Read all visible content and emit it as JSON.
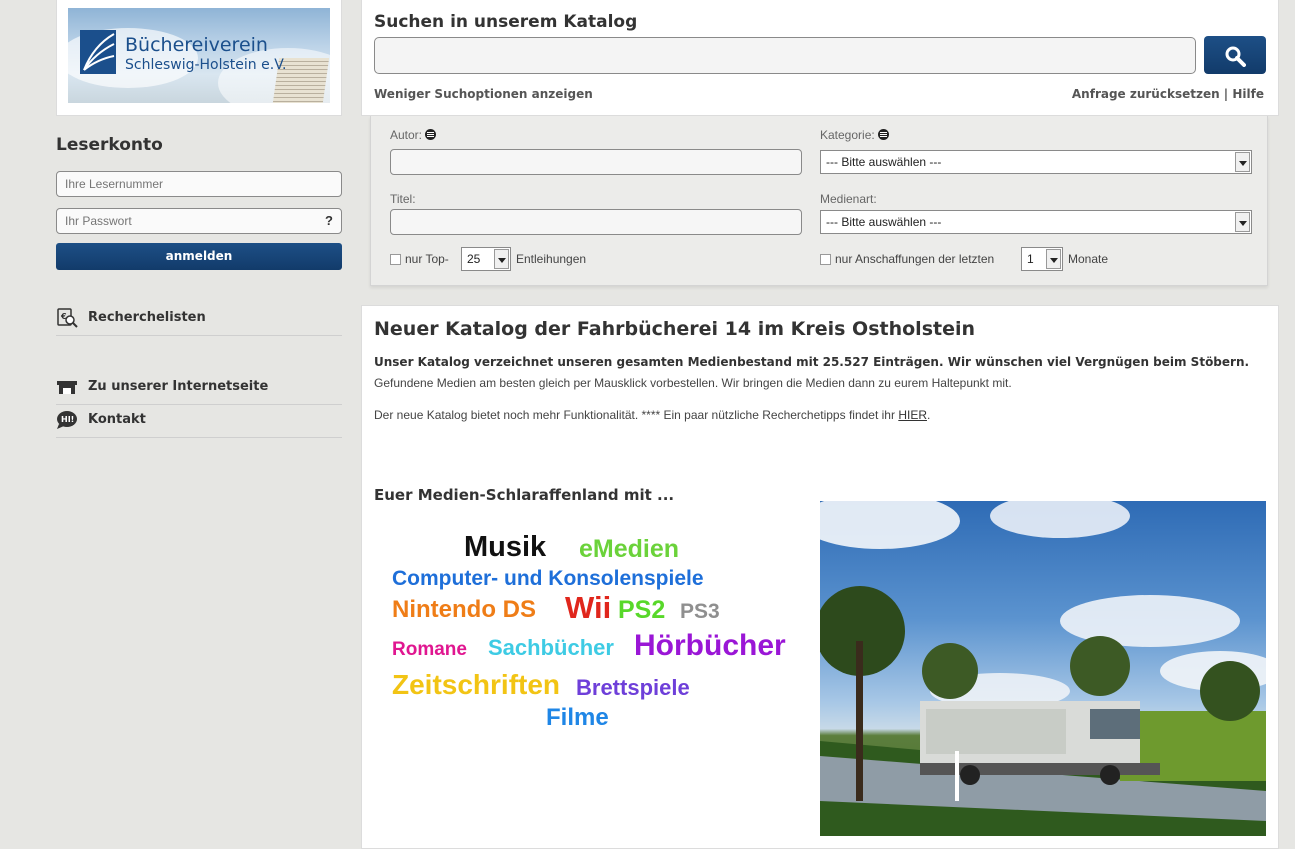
{
  "logo": {
    "line1": "Büchereiverein",
    "line2": "Schleswig-Holstein e.V."
  },
  "account": {
    "title": "Leserkonto",
    "reader_placeholder": "Ihre Lesernummer",
    "password_placeholder": "Ihr Passwort",
    "password_help": "?",
    "login_label": "anmelden"
  },
  "sidebar": {
    "links": [
      {
        "label": "Recherchelisten",
        "icon": "search-list-icon"
      },
      {
        "label": "Zu unserer Internetseite",
        "icon": "storefront-icon"
      },
      {
        "label": "Kontakt",
        "icon": "chat-bubble-icon"
      }
    ]
  },
  "search": {
    "title": "Suchen in unserem Katalog",
    "value": "",
    "options_link": "Weniger Suchoptionen anzeigen",
    "reset_help": "Anfrage zurücksetzen | Hilfe"
  },
  "extended": {
    "author_label": "Autor:",
    "category_label": "Kategorie:",
    "category_value": "--- Bitte auswählen ---",
    "title_label": "Titel:",
    "media_label": "Medienart:",
    "media_value": "--- Bitte auswählen ---",
    "top_prefix": "nur Top-",
    "top_value": "25",
    "top_suffix": "Entleihungen",
    "acq_prefix": "nur Anschaffungen der letzten",
    "acq_value": "1",
    "acq_suffix": "Monate"
  },
  "content": {
    "title": "Neuer Katalog der Fahrbücherei 14 im Kreis Ostholstein",
    "bold_line": "Unser Katalog verzeichnet unseren gesamten Medienbestand mit 25.527 Einträgen. Wir wünschen viel Vergnügen beim Stöbern.",
    "line1": "Gefundene Medien am besten gleich per Mausklick vorbestellen. Wir bringen die Medien dann zu eurem Haltepunkt mit.",
    "line2_prefix": "Der neue Katalog bietet noch mehr Funktionalität. **** Ein paar nützliche Recherchetipps findet ihr ",
    "line2_link": "HIER",
    "line2_suffix": ".",
    "subtitle": "Euer Medien-Schlaraffenland mit ...",
    "cloud": {
      "musik": "Musik",
      "emedien": "eMedien",
      "computer": "Computer- und Konsolenspiele",
      "nintendo": "Nintendo DS",
      "wii": "Wii",
      "ps2": "PS2",
      "ps3": "PS3",
      "romane": "Romane",
      "sachbuecher": "Sachbücher",
      "hoerbuecher": "Hörbücher",
      "zeitschriften": "Zeitschriften",
      "brettspiele": "Brettspiele",
      "filme": "Filme"
    }
  }
}
